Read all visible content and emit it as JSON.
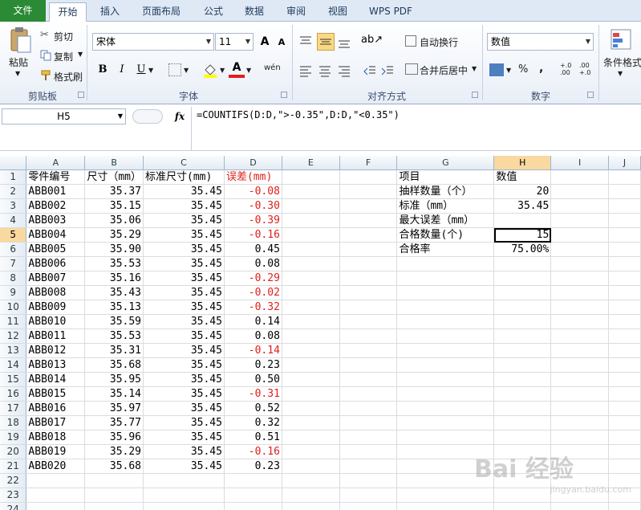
{
  "tabs": [
    "文件",
    "开始",
    "插入",
    "页面布局",
    "公式",
    "数据",
    "审阅",
    "视图",
    "WPS PDF"
  ],
  "ribbon": {
    "clipboard": {
      "paste": "粘贴",
      "cut": "剪切",
      "copy": "复制",
      "format_painter": "格式刷",
      "label": "剪贴板"
    },
    "font": {
      "name": "宋体",
      "size": "11",
      "grow": "A",
      "shrink": "A",
      "bold": "B",
      "italic": "I",
      "underline": "U",
      "font_color_glyph": "A",
      "phonetic": "wén",
      "label": "字体"
    },
    "alignment": {
      "wrap": "自动换行",
      "merge": "合并后居中",
      "label": "对齐方式"
    },
    "number": {
      "format": "数值",
      "percent": "%",
      "comma": ",",
      "inc": "+.0 .00",
      "dec": ".00 +.0",
      "label": "数字"
    },
    "styles": {
      "conditional": "条件格式"
    }
  },
  "formula_bar": {
    "cell": "H5",
    "fx": "fx",
    "formula": "=COUNTIFS(D:D,\">-0.35\",D:D,\"<0.35\")"
  },
  "columns": [
    "A",
    "B",
    "C",
    "D",
    "E",
    "F",
    "G",
    "H",
    "I",
    "J"
  ],
  "rows": [
    {
      "n": "1",
      "a": "零件编号",
      "b": "尺寸（mm）",
      "c": "标准尺寸(mm)",
      "d": "误差(mm)",
      "g": "项目",
      "h": "数值"
    },
    {
      "n": "2",
      "a": "ABB001",
      "b": "35.37",
      "c": "35.45",
      "d": "-0.08",
      "g": "抽样数量（个）",
      "h": "20"
    },
    {
      "n": "3",
      "a": "ABB002",
      "b": "35.15",
      "c": "35.45",
      "d": "-0.30",
      "g": "标准（mm）",
      "h": "35.45"
    },
    {
      "n": "4",
      "a": "ABB003",
      "b": "35.06",
      "c": "35.45",
      "d": "-0.39",
      "g": "最大误差（mm）",
      "h": ""
    },
    {
      "n": "5",
      "a": "ABB004",
      "b": "35.29",
      "c": "35.45",
      "d": "-0.16",
      "g": "合格数量(个)",
      "h": "15"
    },
    {
      "n": "6",
      "a": "ABB005",
      "b": "35.90",
      "c": "35.45",
      "d": "0.45",
      "g": "合格率",
      "h": "75.00%"
    },
    {
      "n": "7",
      "a": "ABB006",
      "b": "35.53",
      "c": "35.45",
      "d": "0.08",
      "g": "",
      "h": ""
    },
    {
      "n": "8",
      "a": "ABB007",
      "b": "35.16",
      "c": "35.45",
      "d": "-0.29",
      "g": "",
      "h": ""
    },
    {
      "n": "9",
      "a": "ABB008",
      "b": "35.43",
      "c": "35.45",
      "d": "-0.02",
      "g": "",
      "h": ""
    },
    {
      "n": "10",
      "a": "ABB009",
      "b": "35.13",
      "c": "35.45",
      "d": "-0.32",
      "g": "",
      "h": ""
    },
    {
      "n": "11",
      "a": "ABB010",
      "b": "35.59",
      "c": "35.45",
      "d": "0.14",
      "g": "",
      "h": ""
    },
    {
      "n": "12",
      "a": "ABB011",
      "b": "35.53",
      "c": "35.45",
      "d": "0.08",
      "g": "",
      "h": ""
    },
    {
      "n": "13",
      "a": "ABB012",
      "b": "35.31",
      "c": "35.45",
      "d": "-0.14",
      "g": "",
      "h": ""
    },
    {
      "n": "14",
      "a": "ABB013",
      "b": "35.68",
      "c": "35.45",
      "d": "0.23",
      "g": "",
      "h": ""
    },
    {
      "n": "15",
      "a": "ABB014",
      "b": "35.95",
      "c": "35.45",
      "d": "0.50",
      "g": "",
      "h": ""
    },
    {
      "n": "16",
      "a": "ABB015",
      "b": "35.14",
      "c": "35.45",
      "d": "-0.31",
      "g": "",
      "h": ""
    },
    {
      "n": "17",
      "a": "ABB016",
      "b": "35.97",
      "c": "35.45",
      "d": "0.52",
      "g": "",
      "h": ""
    },
    {
      "n": "18",
      "a": "ABB017",
      "b": "35.77",
      "c": "35.45",
      "d": "0.32",
      "g": "",
      "h": ""
    },
    {
      "n": "19",
      "a": "ABB018",
      "b": "35.96",
      "c": "35.45",
      "d": "0.51",
      "g": "",
      "h": ""
    },
    {
      "n": "20",
      "a": "ABB019",
      "b": "35.29",
      "c": "35.45",
      "d": "-0.16",
      "g": "",
      "h": ""
    },
    {
      "n": "21",
      "a": "ABB020",
      "b": "35.68",
      "c": "35.45",
      "d": "0.23",
      "g": "",
      "h": ""
    },
    {
      "n": "22",
      "a": "",
      "b": "",
      "c": "",
      "d": "",
      "g": "",
      "h": ""
    },
    {
      "n": "23",
      "a": "",
      "b": "",
      "c": "",
      "d": "",
      "g": "",
      "h": ""
    },
    {
      "n": "24",
      "a": "",
      "b": "",
      "c": "",
      "d": "",
      "g": "",
      "h": ""
    }
  ],
  "selected": {
    "column": "H",
    "row": "5"
  },
  "colors": {
    "negative": "#e0201b",
    "file_tab": "#2a8a35",
    "selection_header": "#f9d99f"
  },
  "watermark": {
    "brand": "Bai 经验",
    "url": "jingyan.baidu.com"
  }
}
